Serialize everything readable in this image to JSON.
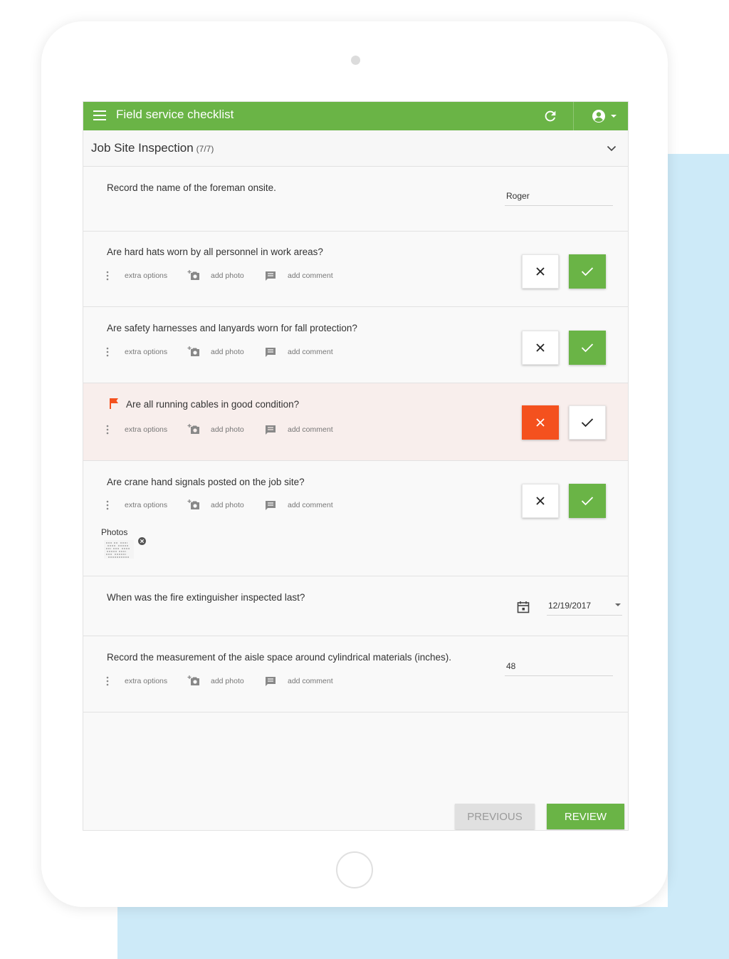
{
  "app": {
    "title": "Field service checklist",
    "accent_color": "#6ab446",
    "flag_color": "#f4511e",
    "icons": [
      "menu-icon",
      "refresh-icon",
      "account-circle-icon",
      "caret-down-icon"
    ]
  },
  "section": {
    "title": "Job Site Inspection",
    "count": "(7/7)"
  },
  "options": {
    "extra": "extra options",
    "photo": "add photo",
    "comment": "add comment"
  },
  "questions": [
    {
      "text": "Record the name of the foreman onsite.",
      "type": "text",
      "value": "Roger"
    },
    {
      "text": "Are hard hats worn by all personnel in work areas?",
      "type": "yes-no",
      "answer": "yes"
    },
    {
      "text": "Are safety harnesses and lanyards worn for fall protection?",
      "type": "yes-no",
      "answer": "yes"
    },
    {
      "text": "Are all running cables in good condition?",
      "type": "yes-no",
      "answer": "no",
      "flagged": true
    },
    {
      "text": "Are crane hand signals posted on the job site?",
      "type": "yes-no",
      "answer": "yes",
      "photos_label": "Photos"
    },
    {
      "text": "When was the fire extinguisher inspected last?",
      "type": "date",
      "value": "12/19/2017"
    },
    {
      "text": "Record the measurement of the aisle space around cylindrical materials (inches).",
      "type": "number",
      "value": "48"
    }
  ],
  "footer": {
    "previous": "PREVIOUS",
    "review": "REVIEW"
  }
}
